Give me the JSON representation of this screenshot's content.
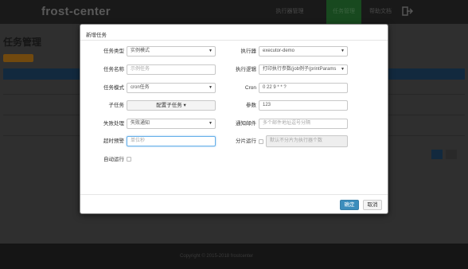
{
  "app": {
    "brand": "frost-center",
    "nav": [
      "执行器管理",
      "任务管理",
      "帮助文档"
    ],
    "page_title": "任务管理",
    "footer": "Copyright © 2015-2018 frostcenter"
  },
  "modal": {
    "title": "新增任务",
    "labels": {
      "task_type": "任务类型",
      "executor": "执行器",
      "task_name": "任务名称",
      "exec_logic": "执行逻辑",
      "task_mode": "任务模式",
      "cron": "Cron",
      "sub_task": "子任务",
      "params": "参数",
      "fail_handling": "失败处理",
      "alarm_email": "通知邮件",
      "timeout_alarm": "超时预警",
      "shard_run": "分片运行",
      "auto_run": "自动运行"
    },
    "values": {
      "task_type": "实例模式",
      "executor": "executor-demo",
      "task_name_placeholder": "示例任务",
      "exec_logic": "打印执行参数(job例子(printParams",
      "task_mode": "cron任务",
      "cron": "0 22 9 * * ?",
      "sub_task_button": "配置子任务 ▾",
      "params": "123",
      "fail_handling": "失败通知",
      "alarm_email_placeholder": "多个邮件地址逗号分隔",
      "timeout_placeholder": "单位秒",
      "shard_placeholder": "默认不分片为执行器个数"
    },
    "buttons": {
      "confirm": "确定",
      "cancel": "取消"
    }
  },
  "colors": {
    "primary": "#3c8dbc",
    "nav_active": "#1e5a26",
    "table_header": "#16324c",
    "accent_button": "#8a5a12"
  }
}
